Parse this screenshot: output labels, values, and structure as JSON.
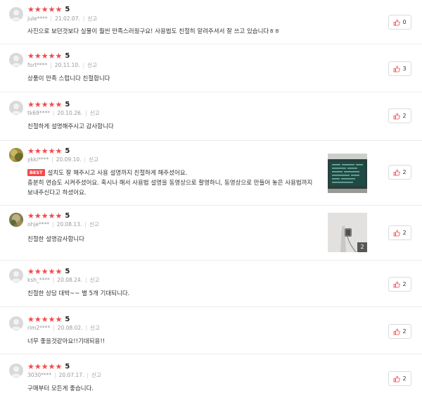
{
  "colors": {
    "star": "#f5484b",
    "best_badge": "#f5484b",
    "border": "#ececec"
  },
  "icons": {
    "star": "star-icon",
    "like": "thumb-up-icon",
    "avatar": "user-avatar-icon"
  },
  "reviews": [
    {
      "rating": "5",
      "user": "jule****",
      "date": "21.02.07.",
      "report": "신고",
      "text": [
        "사진으로 보던것보다 실물이 훨씬 만족스러웠구요! 사용법도 친절히 알려주셔서 잘 쓰고 있습니다ㅎㅎ"
      ],
      "likes": "0"
    },
    {
      "rating": "5",
      "user": "fort****",
      "date": "20.11.10.",
      "report": "신고",
      "text": [
        "상품이 만족 스럽니다 친절합니다"
      ],
      "likes": "3"
    },
    {
      "rating": "5",
      "user": "tk69****",
      "date": "20.10.26.",
      "report": "신고",
      "text": [
        "친절하게 설명해주시고 감사합니다"
      ],
      "likes": "2"
    },
    {
      "rating": "5",
      "user": "ykki****",
      "date": "20.09.10.",
      "report": "신고",
      "best": "BEST",
      "text": [
        "설치도 잘 해주시고 사용 설명까지 친절하게 해주셨어요.",
        "충분히 연습도 시켜주셨어요. 혹시나 해서 사용법 설명을 동영상으로 촬영하니, 동영상으로 만들어 놓은 사용법까지",
        "보내주신다고 하셨어요."
      ],
      "likes": "2"
    },
    {
      "rating": "5",
      "user": "ohje****",
      "date": "20.08.13.",
      "report": "신고",
      "text": [
        "친절한 설명감사합니다"
      ],
      "likes": "2",
      "photo_count": "2"
    },
    {
      "rating": "5",
      "user": "ksh_****",
      "date": "20.08.24.",
      "report": "신고",
      "text": [
        "친절한 상담 대박~~ 별 5개 기대되니다."
      ],
      "likes": "2"
    },
    {
      "rating": "5",
      "user": "rim2****",
      "date": "20.08.02.",
      "report": "신고",
      "text": [
        "너무 좋을것같아요!!기대되용!!"
      ],
      "likes": "2"
    },
    {
      "rating": "5",
      "user": "3030****",
      "date": "20.07.17.",
      "report": "신고",
      "text": [
        "구매부터 모든게 좋습니다."
      ],
      "likes": "2"
    }
  ]
}
